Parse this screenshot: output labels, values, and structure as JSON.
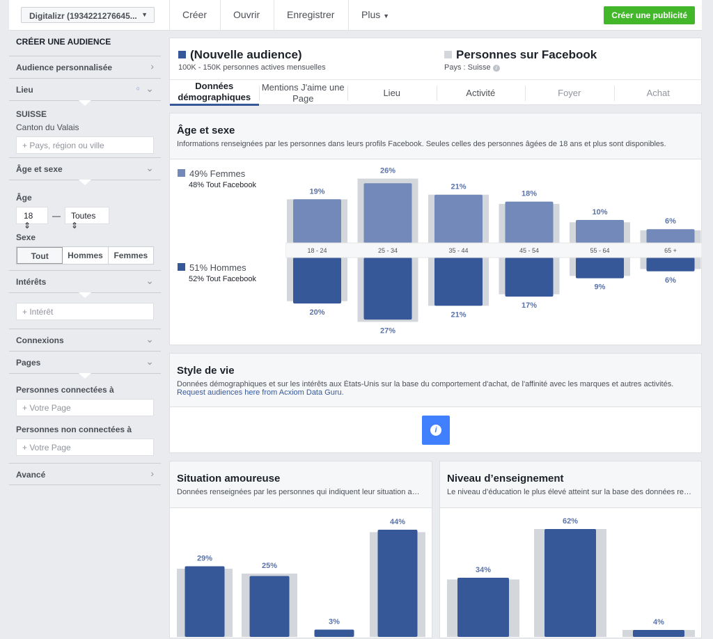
{
  "topbar": {
    "account": "Digitalizr (1934221276645...",
    "menu": [
      "Créer",
      "Ouvrir",
      "Enregistrer",
      "Plus"
    ],
    "cta": "Créer une publicité"
  },
  "sidebar": {
    "title": "CRÉER UNE AUDIENCE",
    "custom": "Audience personnalisée",
    "lieu": "Lieu",
    "country": "SUISSE",
    "region": "Canton du Valais",
    "lieu_placeholder": "Pays, région ou ville",
    "age_sexe": "Âge et sexe",
    "age_label": "Âge",
    "age_from": "18",
    "age_to": "Toutes",
    "sexe_label": "Sexe",
    "sexe_options": [
      "Tout",
      "Hommes",
      "Femmes"
    ],
    "interets": "Intérêts",
    "interet_placeholder": "Intérêt",
    "connexions": "Connexions",
    "pages": "Pages",
    "connected": "Personnes connectées à",
    "not_connected": "Personnes non connectées à",
    "page_placeholder": "Votre Page",
    "avance": "Avancé"
  },
  "header": {
    "audience_title": "(Nouvelle audience)",
    "audience_sub": "100K - 150K personnes actives mensuelles",
    "fb_title": "Personnes sur Facebook",
    "fb_sub": "Pays : Suisse",
    "audience_color": "#365899",
    "fb_color": "#d3d6db"
  },
  "tabs": [
    {
      "label": "Données démographiques",
      "state": "active"
    },
    {
      "label": "Mentions J'aime une Page"
    },
    {
      "label": "Lieu"
    },
    {
      "label": "Activité"
    },
    {
      "label": "Foyer",
      "state": "disabled"
    },
    {
      "label": "Achat",
      "state": "disabled"
    }
  ],
  "age_card": {
    "title": "Âge et sexe",
    "desc": "Informations renseignées par les personnes dans leurs profils Facebook. Seules celles des personnes âgées de 18 ans et plus sont disponibles.",
    "women": "49% Femmes",
    "women_fb": "48% Tout Facebook",
    "men": "51% Hommes",
    "men_fb": "52% Tout Facebook"
  },
  "lifestyle": {
    "title": "Style de vie",
    "desc": "Données démographiques et sur les intérêts aux États-Unis sur la base du comportement d'achat, de l'affinité avec les marques et autres activités.",
    "link": "Request audiences here from Acxiom Data Guru."
  },
  "relationship": {
    "title": "Situation amoureuse",
    "desc": "Données renseignées par les personnes qui indiquent leur situation amoureuse sur Facebook."
  },
  "education": {
    "title": "Niveau d’enseignement",
    "desc": "Le niveau d’éducation le plus élevé atteint sur la base des données renseignées."
  },
  "chart_data": [
    {
      "type": "bar",
      "name": "age-gender",
      "categories": [
        "18 - 24",
        "25 - 34",
        "35 - 44",
        "45 - 54",
        "55 - 64",
        "65 +"
      ],
      "series": [
        {
          "name": "Femmes",
          "values": [
            19,
            26,
            21,
            18,
            10,
            6
          ],
          "facebook_all": [
            19,
            28,
            21,
            17,
            9,
            5.5
          ],
          "color": "#7289b9",
          "labels": [
            "19%",
            "26%",
            "21%",
            "18%",
            "10%",
            "6%"
          ]
        },
        {
          "name": "Hommes",
          "values": [
            20,
            27,
            21,
            17,
            9,
            6
          ],
          "facebook_all": [
            19,
            28,
            21,
            16,
            8,
            5
          ],
          "color": "#365899",
          "labels": [
            "20%",
            "27%",
            "21%",
            "17%",
            "9%",
            "6%"
          ]
        }
      ]
    },
    {
      "type": "bar",
      "name": "relationship",
      "values": [
        29,
        25,
        3,
        44
      ],
      "facebook_all": [
        28,
        26,
        0,
        43
      ],
      "labels": [
        "29%",
        "25%",
        "3%",
        "44%"
      ]
    },
    {
      "type": "bar",
      "name": "education",
      "values": [
        34,
        62,
        4
      ],
      "facebook_all": [
        33,
        62,
        4
      ],
      "labels": [
        "34%",
        "62%",
        "4%"
      ]
    }
  ]
}
